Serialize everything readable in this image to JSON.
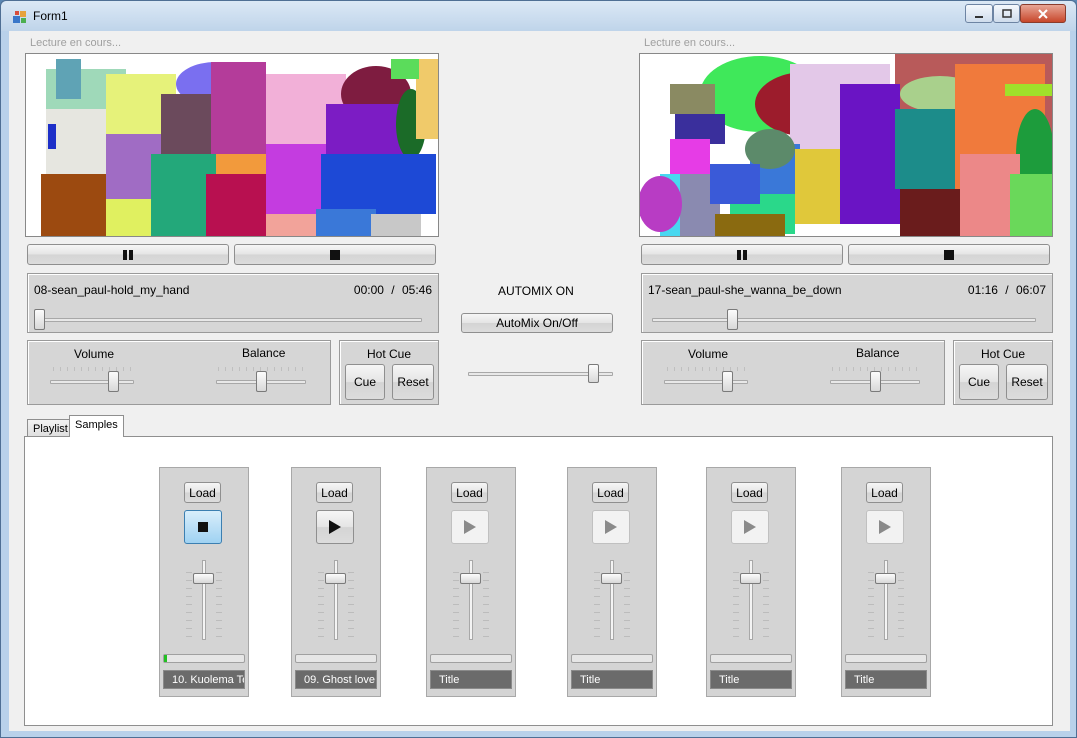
{
  "window": {
    "title": "Form1"
  },
  "deck_left": {
    "status": "Lecture en cours...",
    "track_name": "08-sean_paul-hold_my_hand",
    "time_current": "00:00",
    "time_separator": "/",
    "time_total": "05:46",
    "position": 0.0,
    "volume_label": "Volume",
    "balance_label": "Balance",
    "volume": 0.78,
    "balance": 0.5,
    "hotcue_label": "Hot Cue",
    "cue_label": "Cue",
    "reset_label": "Reset"
  },
  "deck_right": {
    "status": "Lecture en cours...",
    "track_name": "17-sean_paul-she_wanna_be_down",
    "time_current": "01:16",
    "time_separator": "/",
    "time_total": "06:07",
    "position": 0.21,
    "volume_label": "Volume",
    "balance_label": "Balance",
    "volume": 0.78,
    "balance": 0.5,
    "hotcue_label": "Hot Cue",
    "cue_label": "Cue",
    "reset_label": "Reset"
  },
  "automix": {
    "status": "AUTOMIX ON",
    "button_label": "AutoMix On/Off",
    "crossfader": 0.85
  },
  "tabs": [
    {
      "label": "Playlist"
    },
    {
      "label": "Samples"
    }
  ],
  "samplers": [
    {
      "load_label": "Load",
      "title": "10. Kuolema Te",
      "state": "stop",
      "volume": 0.25,
      "progress": 0.04
    },
    {
      "load_label": "Load",
      "title": "09. Ghost love",
      "state": "play",
      "volume": 0.25,
      "progress": 0.0
    },
    {
      "load_label": "Load",
      "title": "Title",
      "state": "play-disabled",
      "volume": 0.25,
      "progress": 0.0
    },
    {
      "load_label": "Load",
      "title": "Title",
      "state": "play-disabled",
      "volume": 0.25,
      "progress": 0.0
    },
    {
      "load_label": "Load",
      "title": "Title",
      "state": "play-disabled",
      "volume": 0.25,
      "progress": 0.0
    },
    {
      "load_label": "Load",
      "title": "Title",
      "state": "play-disabled",
      "volume": 0.25,
      "progress": 0.0
    }
  ],
  "colors": {
    "accent": "#9fd2f2",
    "progress_fill": "#22c022",
    "title_bg": "#6b6b6b"
  }
}
